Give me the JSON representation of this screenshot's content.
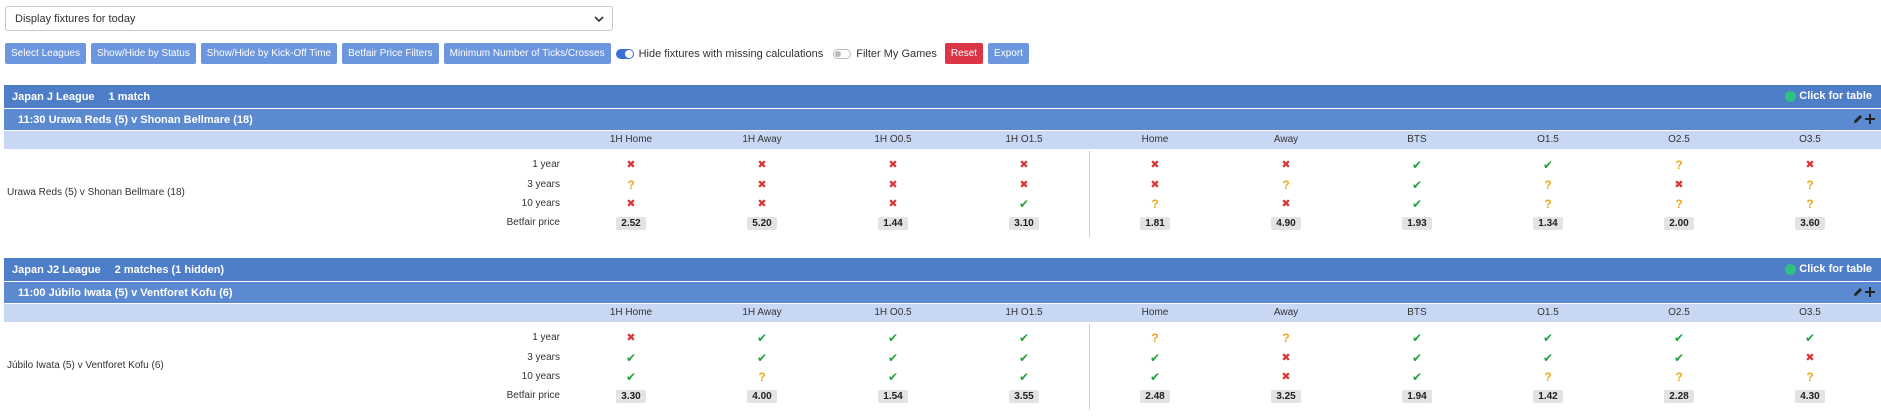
{
  "filter_select": {
    "value": "Display fixtures for today"
  },
  "toolbar": {
    "select_leagues": "Select Leagues",
    "show_hide_status": "Show/Hide by Status",
    "show_hide_kickoff": "Show/Hide by Kick-Off Time",
    "betfair_filters": "Betfair Price Filters",
    "min_ticks": "Minimum Number of Ticks/Crosses",
    "hide_missing_label": "Hide fixtures with missing calculations",
    "hide_missing_on": true,
    "filter_my_games_label": "Filter My Games",
    "filter_my_games_on": false,
    "reset": "Reset",
    "export": "Export"
  },
  "columns": [
    "1H Home",
    "1H Away",
    "1H O0.5",
    "1H O1.5",
    "Home",
    "Away",
    "BTS",
    "O1.5",
    "O2.5",
    "O3.5"
  ],
  "row_labels": [
    "1 year",
    "3 years",
    "10 years",
    "Betfair price"
  ],
  "click_for_table": "Click for table",
  "leagues": [
    {
      "name": "Japan J League",
      "count": "1 match",
      "match": {
        "header": "11:30 Urawa Reds (5) v Shonan Bellmare (18)",
        "name": "Urawa Reds (5) v Shonan Bellmare (18)",
        "rows": [
          [
            "cross",
            "cross",
            "cross",
            "cross",
            "cross",
            "cross",
            "tick",
            "tick",
            "q",
            "cross"
          ],
          [
            "q",
            "cross",
            "cross",
            "cross",
            "cross",
            "q",
            "tick",
            "q",
            "cross",
            "q"
          ],
          [
            "cross",
            "cross",
            "cross",
            "tick",
            "q",
            "cross",
            "tick",
            "q",
            "q",
            "q"
          ]
        ],
        "prices": [
          "2.52",
          "5.20",
          "1.44",
          "3.10",
          "1.81",
          "4.90",
          "1.93",
          "1.34",
          "2.00",
          "3.60"
        ]
      }
    },
    {
      "name": "Japan J2 League",
      "count": "2 matches (1 hidden)",
      "match": {
        "header": "11:00 Júbilo Iwata (5) v Ventforet Kofu (6)",
        "name": "Júbilo Iwata (5) v Ventforet Kofu (6)",
        "rows": [
          [
            "cross",
            "tick",
            "tick",
            "tick",
            "q",
            "q",
            "tick",
            "tick",
            "tick",
            "tick"
          ],
          [
            "tick",
            "tick",
            "tick",
            "tick",
            "tick",
            "cross",
            "tick",
            "tick",
            "tick",
            "cross"
          ],
          [
            "tick",
            "q",
            "tick",
            "tick",
            "tick",
            "cross",
            "tick",
            "q",
            "q",
            "q"
          ]
        ],
        "prices": [
          "3.30",
          "4.00",
          "1.54",
          "3.55",
          "2.48",
          "3.25",
          "1.94",
          "1.42",
          "2.28",
          "4.30"
        ]
      }
    }
  ]
}
